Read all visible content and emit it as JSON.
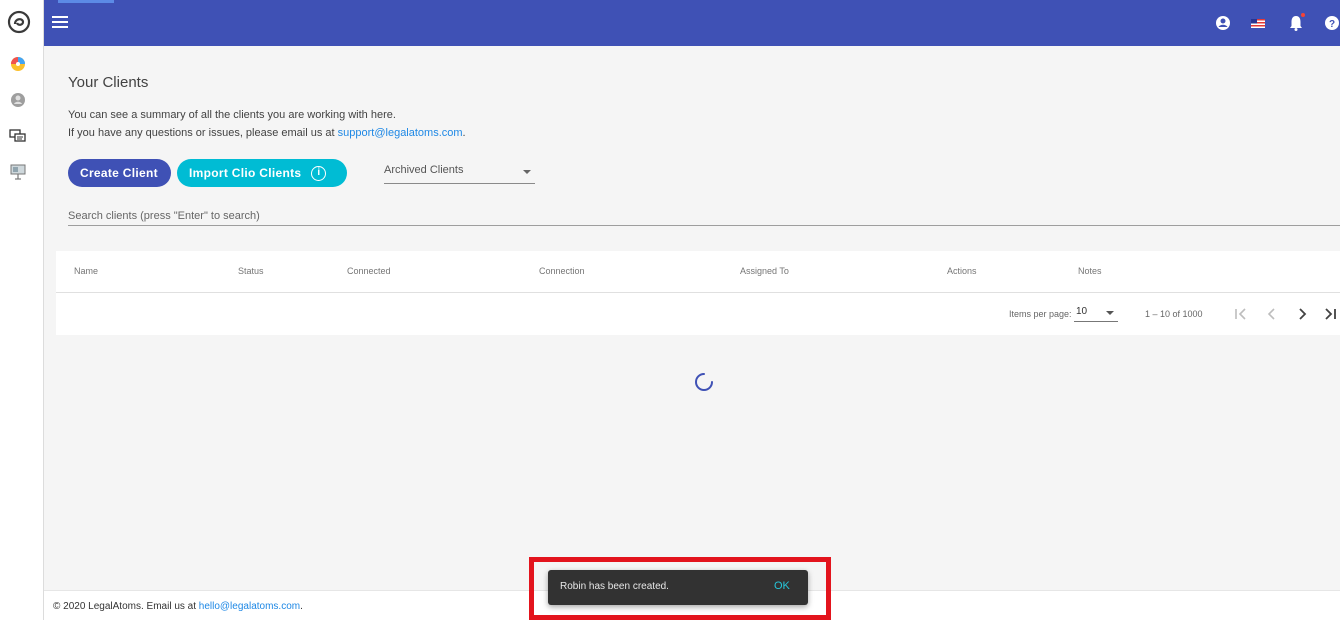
{
  "sidebar": {
    "logo_icon": "legalatoms-logo-icon",
    "items": [
      {
        "icon": "dashboard-icon"
      },
      {
        "icon": "clients-icon"
      },
      {
        "icon": "messages-icon"
      },
      {
        "icon": "presentation-icon"
      }
    ]
  },
  "topbar": {
    "color": "#3f51b5",
    "menu_icon": "hamburger-menu-icon",
    "icons": [
      "account-icon",
      "flag-icon",
      "notifications-icon",
      "help-icon"
    ]
  },
  "main": {
    "title": "Your Clients",
    "description_line1": "You can see a summary of all the clients you are working with here.",
    "description_line2_prefix": "If you have any questions or issues, please email us at ",
    "support_email": "support@legalatoms.com",
    "description_line2_suffix": ".",
    "create_button": "Create Client",
    "import_button": "Import Clio Clients",
    "archived_select": "Archived Clients",
    "search_placeholder": "Search clients (press \"Enter\" to search)"
  },
  "table": {
    "columns": [
      "Name",
      "Status",
      "Connected",
      "Connection",
      "Assigned To",
      "Actions",
      "Notes"
    ]
  },
  "paginator": {
    "items_per_page_label": "Items per page:",
    "page_size": "10",
    "range": "1 – 10 of 1000"
  },
  "footer": {
    "prefix": "© 2020 LegalAtoms.  Email us at ",
    "email": "hello@legalatoms.com",
    "suffix": "."
  },
  "snackbar": {
    "message": "Robin has been created.",
    "action": "OK"
  },
  "colors": {
    "primary": "#3f51b5",
    "accent": "#00bcd4",
    "link": "#1e88e5",
    "highlight": "#e3141d"
  }
}
